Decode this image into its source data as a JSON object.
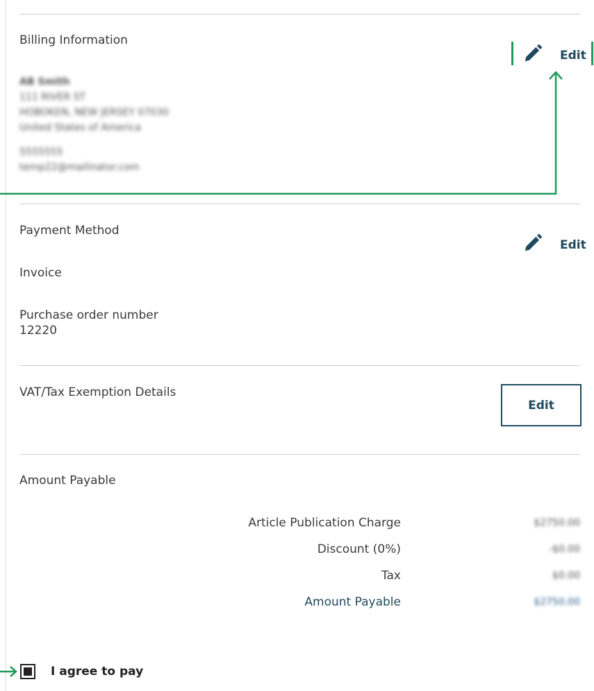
{
  "billing": {
    "title": "Billing Information",
    "edit_label": "Edit",
    "address_lines": [
      "AB Smith",
      "111 RIVER ST",
      "HOBOKEN, NEW JERSEY 07030",
      "United States of America"
    ],
    "contact_lines": [
      "5555555",
      "temp22@mailinator.com"
    ]
  },
  "payment": {
    "title": "Payment Method",
    "edit_label": "Edit",
    "method": "Invoice",
    "po_label": "Purchase order number",
    "po_value": "12220"
  },
  "vat": {
    "title": "VAT/Tax Exemption Details",
    "edit_label": "Edit"
  },
  "amount": {
    "title": "Amount Payable",
    "rows": [
      {
        "label": "Article Publication Charge",
        "value": "$2750.00"
      },
      {
        "label": "Discount  (0%)",
        "value": "-$0.00"
      },
      {
        "label": "Tax",
        "value": "$0.00"
      },
      {
        "label": "Amount Payable",
        "value": "$2750.00"
      }
    ]
  },
  "agree": {
    "label": "I agree to pay",
    "checked": true
  },
  "colors": {
    "accent": "#1f4a5e",
    "annotation": "#1e9a5a"
  },
  "icons": {
    "edit": "pencil-icon"
  }
}
